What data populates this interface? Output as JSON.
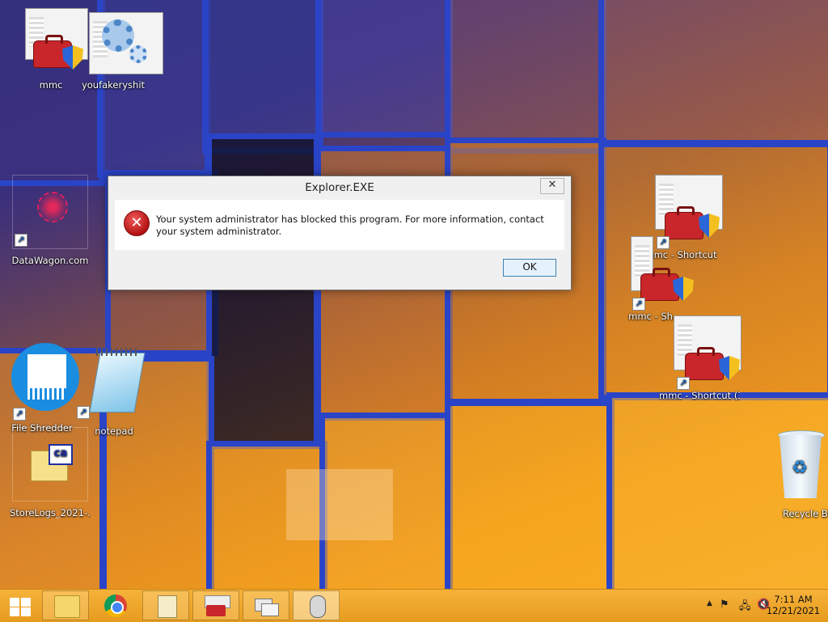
{
  "desktop_icons": [
    {
      "label": "mmc"
    },
    {
      "label": "youfakeryshit"
    },
    {
      "label": "DataWagon.com"
    },
    {
      "label": "File Shredder"
    },
    {
      "label": "notepad"
    },
    {
      "label": "StoreLogs_2021-..."
    },
    {
      "label": "mmc - Shortcut"
    },
    {
      "label": "mmc - Sh..."
    },
    {
      "label": "mmc - Shortcut (3)"
    },
    {
      "label": "Recycle Bin"
    }
  ],
  "dialog": {
    "title": "Explorer.EXE",
    "close_glyph": "✕",
    "message": "Your system administrator has blocked this program. For more information, contact your system administrator.",
    "ok_label": "OK"
  },
  "taskbar": {
    "buttons": [
      {
        "name": "file-explorer",
        "icon": "folder-icon"
      },
      {
        "name": "chrome",
        "icon": "chrome-icon"
      },
      {
        "name": "notepad",
        "icon": "notepad-icon"
      },
      {
        "name": "mmc",
        "icon": "toolbox-icon"
      },
      {
        "name": "task-view",
        "icon": "windows-icon"
      },
      {
        "name": "mouse",
        "icon": "mouse-icon"
      }
    ],
    "clock": {
      "time": "7:11 AM",
      "date": "12/21/2021"
    }
  },
  "colors": {
    "accent": "#2a44c8",
    "taskbar": "#eea22a"
  }
}
